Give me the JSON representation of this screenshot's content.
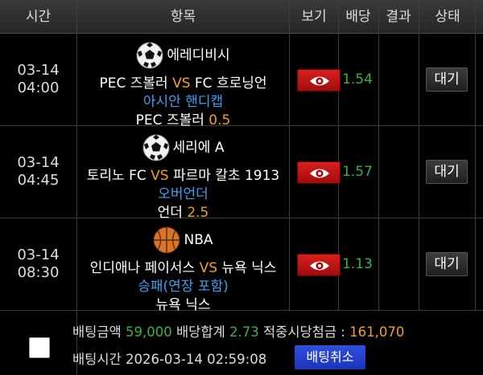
{
  "header": {
    "time": "시간",
    "item": "항목",
    "view": "보기",
    "odds": "배당",
    "result": "결과",
    "status": "상태"
  },
  "rows": [
    {
      "date": "03-14",
      "time": "04:00",
      "sport_icon": "soccer-ball-icon",
      "league": "에레디비시",
      "home": "PEC 즈볼러",
      "vs": "VS",
      "away": "FC 흐로닝언",
      "market": "아시안 핸디캡",
      "pick": "PEC 즈볼러",
      "pick_value": "0.5",
      "odds": "1.54",
      "status": "대기"
    },
    {
      "date": "03-14",
      "time": "04:45",
      "sport_icon": "soccer-ball-icon",
      "league": "세리에 A",
      "home": "토리노 FC",
      "vs": "VS",
      "away": "파르마 칼초 1913",
      "market": "오버언더",
      "pick": "언더",
      "pick_value": "2.5",
      "odds": "1.57",
      "status": "대기"
    },
    {
      "date": "03-14",
      "time": "08:30",
      "sport_icon": "basketball-icon",
      "league": "NBA",
      "home": "인디애나 페이서스",
      "vs": "VS",
      "away": "뉴욕 닉스",
      "market": "승패(연장 포함)",
      "pick": "뉴욕 닉스",
      "pick_value": "",
      "odds": "1.13",
      "status": "대기"
    }
  ],
  "footer": {
    "bet_amount_label": "배팅금액",
    "bet_amount": "59,000",
    "odds_total_label": "배당합계",
    "odds_total": "2.73",
    "payout_label": "적중시당첨금 :",
    "payout": "161,070",
    "bet_time_label": "배팅시간",
    "bet_time": "2026-03-14 02:59:08",
    "cancel_label": "배팅취소"
  },
  "colors": {
    "vs": "#f0a020",
    "market": "#3ba0f0",
    "odds": "#3cb043",
    "eye_button": "#c01515",
    "cancel_button": "#2a46d8"
  }
}
